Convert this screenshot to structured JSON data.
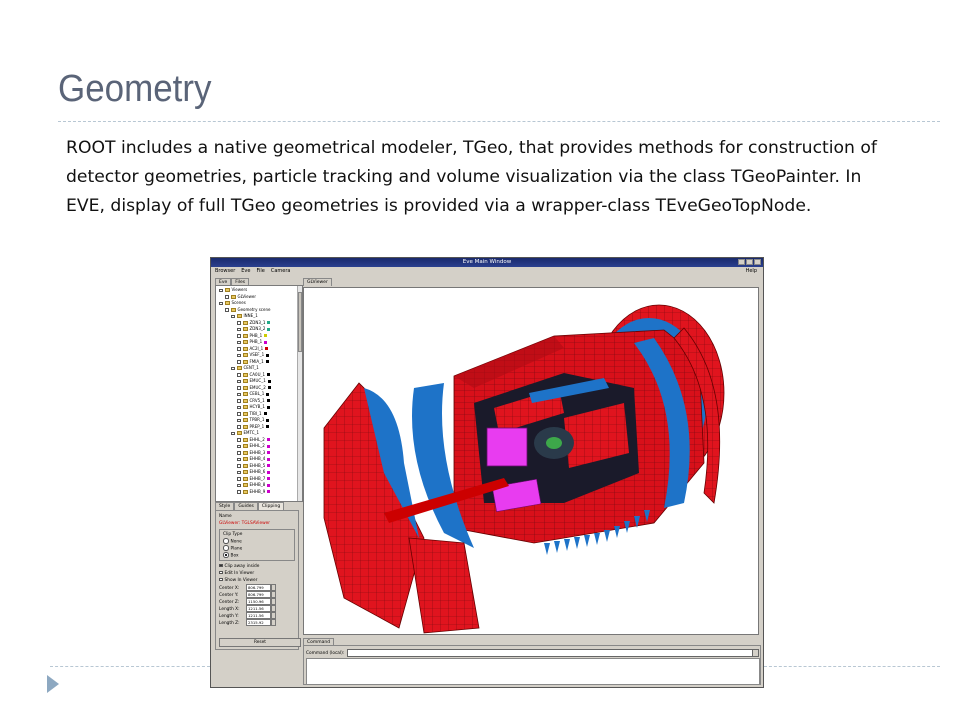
{
  "slide": {
    "title": "Geometry",
    "body": "ROOT includes a native geometrical modeler, TGeo, that provides methods for construction of detector geometries, particle tracking and volume visualization via the class TGeoPainter. In EVE, display of full TGeo geometries is provided via a wrapper-class TEveGeoTopNode."
  },
  "screenshot": {
    "window_title": "Eve Main Window",
    "menu": [
      "Browser",
      "Eve",
      "File",
      "Camera"
    ],
    "help": "Help",
    "left_tabs": [
      "Eve",
      "Files"
    ],
    "tree": [
      {
        "label": "Viewers",
        "indent": 0
      },
      {
        "label": "GLViewer",
        "indent": 1
      },
      {
        "label": "Scenes",
        "indent": 0
      },
      {
        "label": "Geometry scene",
        "indent": 1
      },
      {
        "label": "INNE_1",
        "indent": 2
      },
      {
        "label": "ZDN3_1",
        "indent": 3,
        "color": "#2a8"
      },
      {
        "label": "ZDN3_2",
        "indent": 3,
        "color": "#2a8"
      },
      {
        "label": "PHB_1",
        "indent": 3,
        "color": "#cc0"
      },
      {
        "label": "PHB_1",
        "indent": 3,
        "color": "#c0c"
      },
      {
        "label": "AC2I_1",
        "indent": 3,
        "color": "#c00"
      },
      {
        "label": "VSEF_1",
        "indent": 3,
        "color": "#000"
      },
      {
        "label": "FMIA_1",
        "indent": 3,
        "color": "#000"
      },
      {
        "label": "CENT_1",
        "indent": 2
      },
      {
        "label": "CA0U_1",
        "indent": 3,
        "color": "#000"
      },
      {
        "label": "EMUC_1",
        "indent": 3,
        "color": "#000"
      },
      {
        "label": "EMUC_2",
        "indent": 3,
        "color": "#000"
      },
      {
        "label": "CEBL_1",
        "indent": 3,
        "color": "#000"
      },
      {
        "label": "CRV5_1",
        "indent": 3,
        "color": "#000"
      },
      {
        "label": "HCYB_1",
        "indent": 3,
        "color": "#000"
      },
      {
        "label": "TIBI_1",
        "indent": 3,
        "color": "#000"
      },
      {
        "label": "TPBR_1",
        "indent": 3,
        "color": "#000"
      },
      {
        "label": "PREP_1",
        "indent": 3,
        "color": "#000"
      },
      {
        "label": "EMTC_1",
        "indent": 2
      },
      {
        "label": "EHHL_2",
        "indent": 3,
        "color": "#c0c"
      },
      {
        "label": "EHHL_2",
        "indent": 3,
        "color": "#c0c"
      },
      {
        "label": "EHHB_3",
        "indent": 3,
        "color": "#c0c"
      },
      {
        "label": "EHHB_4",
        "indent": 3,
        "color": "#c0c"
      },
      {
        "label": "EHHB_5",
        "indent": 3,
        "color": "#c0c"
      },
      {
        "label": "EHHB_6",
        "indent": 3,
        "color": "#c0c"
      },
      {
        "label": "EHHB_7",
        "indent": 3,
        "color": "#c0c"
      },
      {
        "label": "EHHB_8",
        "indent": 3,
        "color": "#c0c"
      },
      {
        "label": "EHHB_9",
        "indent": 3,
        "color": "#c0c"
      }
    ],
    "editor_tabs": [
      "Style",
      "Guides",
      "Clipping"
    ],
    "editor": {
      "name_label": "Name",
      "name_value": "GLViewer: TGLSAViewer",
      "clip_type_label": "Clip Type",
      "clip_options": [
        "None",
        "Plane",
        "Box"
      ],
      "clip_selected": "Box",
      "checks": [
        {
          "label": "Clip away inside",
          "checked": true
        },
        {
          "label": "Edit In Viewer",
          "checked": false
        },
        {
          "label": "Show In Viewer",
          "checked": false
        }
      ],
      "fields": [
        {
          "label": "Center X:",
          "value": "806.799"
        },
        {
          "label": "Center Y:",
          "value": "806.799"
        },
        {
          "label": "Center Z:",
          "value": "1150.96"
        },
        {
          "label": "Length X:",
          "value": "1211.56"
        },
        {
          "label": "Length Y:",
          "value": "1211.56"
        },
        {
          "label": "Length Z:",
          "value": "2315.92"
        }
      ],
      "reset": "Reset"
    },
    "gl_tab": "GLViewer",
    "command_tab": "Command",
    "command_label": "Command (local):"
  },
  "colors": {
    "title": "#5a6478",
    "rule": "#b8c7d3",
    "bullet": "#8da8c1",
    "detector_red": "#e0141e",
    "detector_blue": "#1e73c8",
    "detector_magenta": "#e83cf0"
  }
}
